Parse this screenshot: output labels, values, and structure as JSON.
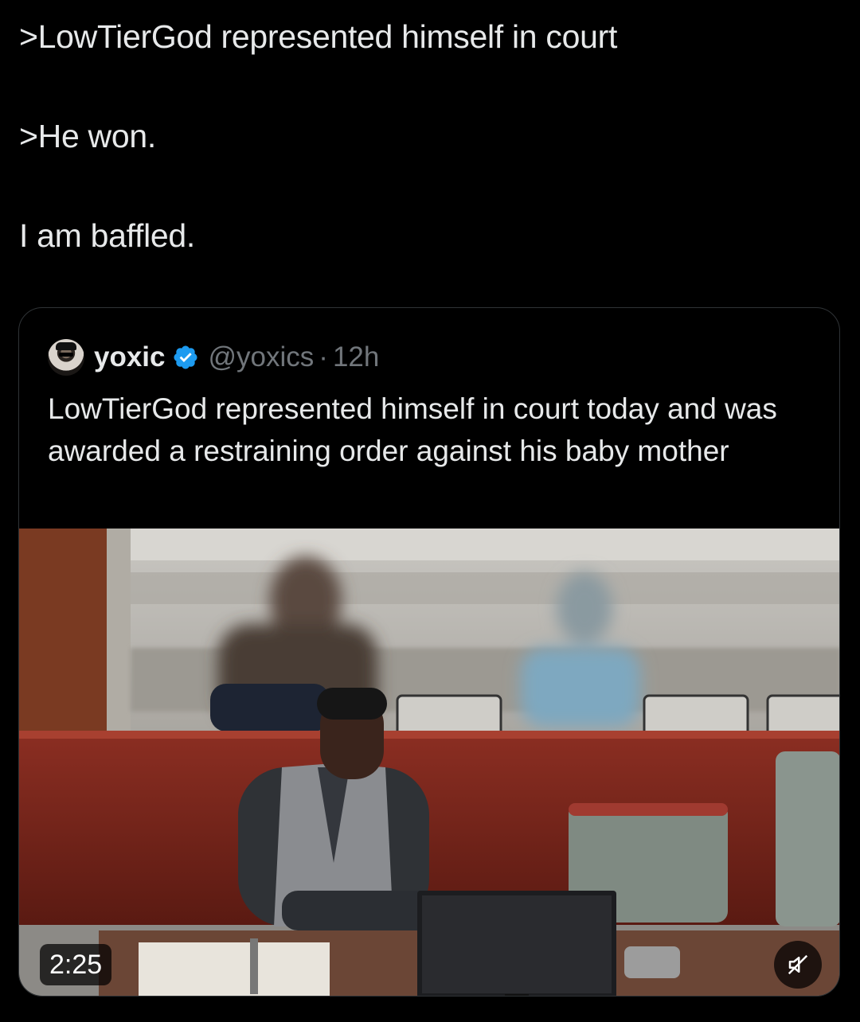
{
  "post": {
    "lines": [
      ">LowTierGod represented himself in court",
      ">He won.",
      "I am baffled."
    ]
  },
  "quoted_post": {
    "display_name": "yoxic",
    "verified": true,
    "handle": "@yoxics",
    "separator": "·",
    "time": "12h",
    "text": "LowTierGod represented himself in court today and was awarded a restraining order against his baby mother",
    "video": {
      "duration": "2:25",
      "muted": true
    }
  },
  "colors": {
    "background": "#000000",
    "text_primary": "#e7e9ea",
    "text_secondary": "#71767b",
    "verified_blue": "#1d9bf0",
    "card_border": "#2f3336"
  },
  "icons": {
    "verified": "verified-badge-icon",
    "mute": "speaker-muted-icon"
  }
}
